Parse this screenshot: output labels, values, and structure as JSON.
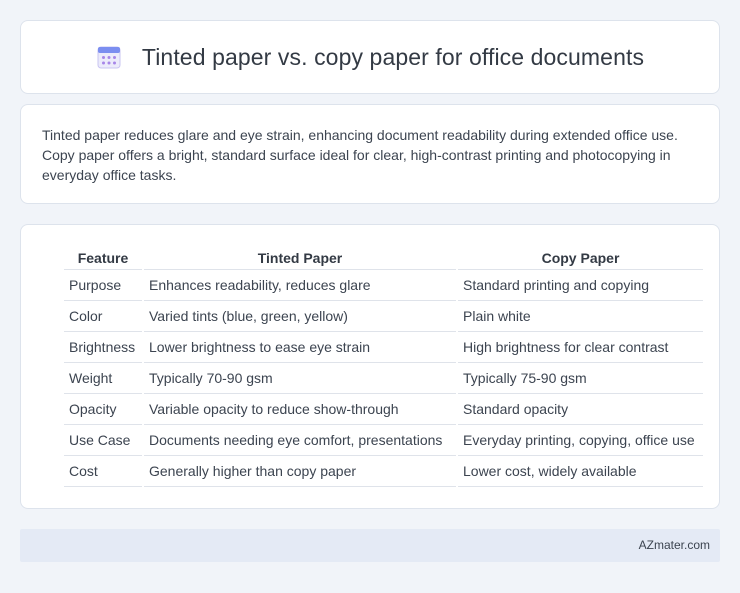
{
  "header": {
    "title": "Tinted paper vs. copy paper for office documents",
    "icon": "calendar-icon",
    "icon_colors": {
      "top": "#7b8ef0",
      "body": "#ecebfb",
      "dots": "#a786e8"
    }
  },
  "summary": {
    "text": "Tinted paper reduces glare and eye strain, enhancing document readability during extended office use. Copy paper offers a bright, standard surface ideal for clear, high-contrast printing and photocopying in everyday office tasks."
  },
  "table": {
    "headers": [
      "Feature",
      "Tinted Paper",
      "Copy Paper"
    ],
    "rows": [
      [
        "Purpose",
        "Enhances readability, reduces glare",
        "Standard printing and copying"
      ],
      [
        "Color",
        "Varied tints (blue, green, yellow)",
        "Plain white"
      ],
      [
        "Brightness",
        "Lower brightness to ease eye strain",
        "High brightness for clear contrast"
      ],
      [
        "Weight",
        "Typically 70-90 gsm",
        "Typically 75-90 gsm"
      ],
      [
        "Opacity",
        "Variable opacity to reduce show-through",
        "Standard opacity"
      ],
      [
        "Use Case",
        "Documents needing eye comfort, presentations",
        "Everyday printing, copying, office use"
      ],
      [
        "Cost",
        "Generally higher than copy paper",
        "Lower cost, widely available"
      ]
    ]
  },
  "footer": {
    "brand": "AZmater.com"
  }
}
